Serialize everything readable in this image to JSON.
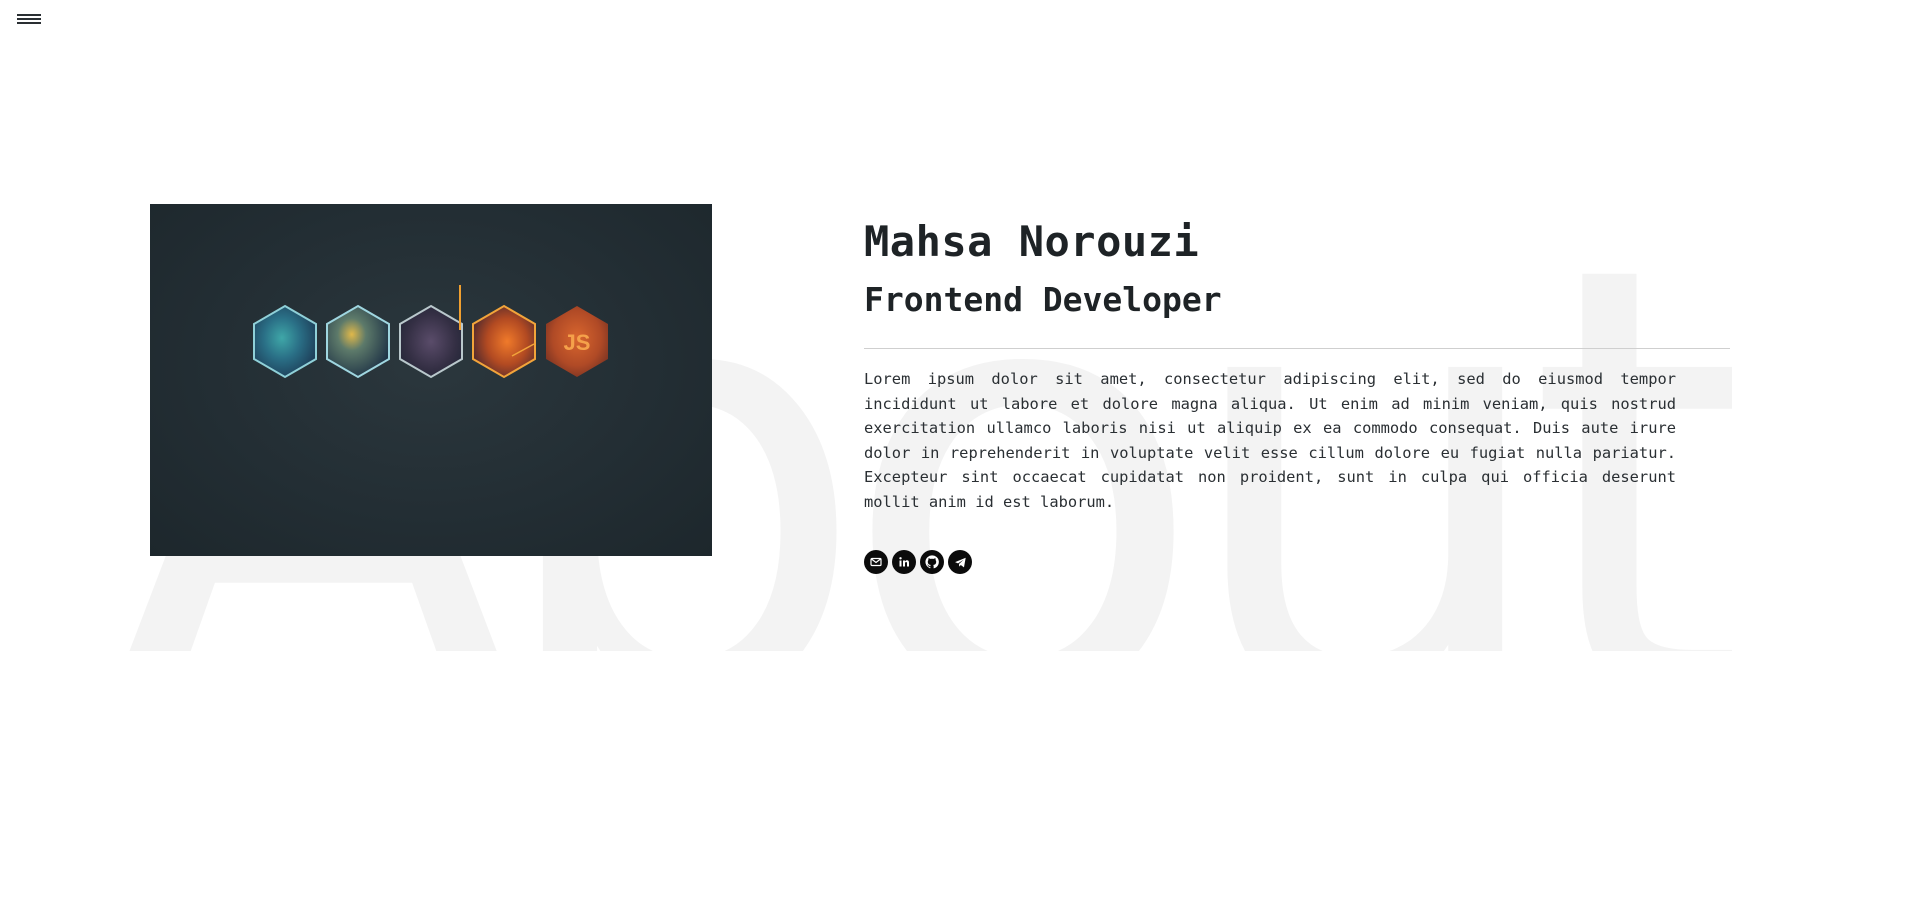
{
  "nav": {
    "menu_icon": "hamburger-menu-icon"
  },
  "background_text": "About",
  "hero_image": {
    "logo_text": "JS",
    "accent_color": "#f08a2c"
  },
  "profile": {
    "name": "Mahsa Norouzi",
    "title": "Frontend Developer",
    "bio": "Lorem ipsum dolor sit amet, consectetur adipiscing elit, sed do eiusmod tempor incididunt ut labore et dolore magna aliqua. Ut enim ad minim veniam, quis nostrud exercitation ullamco laboris nisi ut aliquip ex ea commodo consequat. Duis aute irure dolor in reprehenderit in voluptate velit esse cillum dolore eu fugiat nulla pariatur. Excepteur sint occaecat cupidatat non proident, sunt in culpa qui officia deserunt mollit anim id est laborum."
  },
  "socials": [
    {
      "icon": "mail-icon"
    },
    {
      "icon": "linkedin-icon"
    },
    {
      "icon": "github-icon"
    },
    {
      "icon": "telegram-icon"
    }
  ],
  "colors": {
    "text": "#1e2326",
    "background_text": "#f3f3f3",
    "image_background": "#232e34",
    "social_circle": "#0b0b0b"
  }
}
